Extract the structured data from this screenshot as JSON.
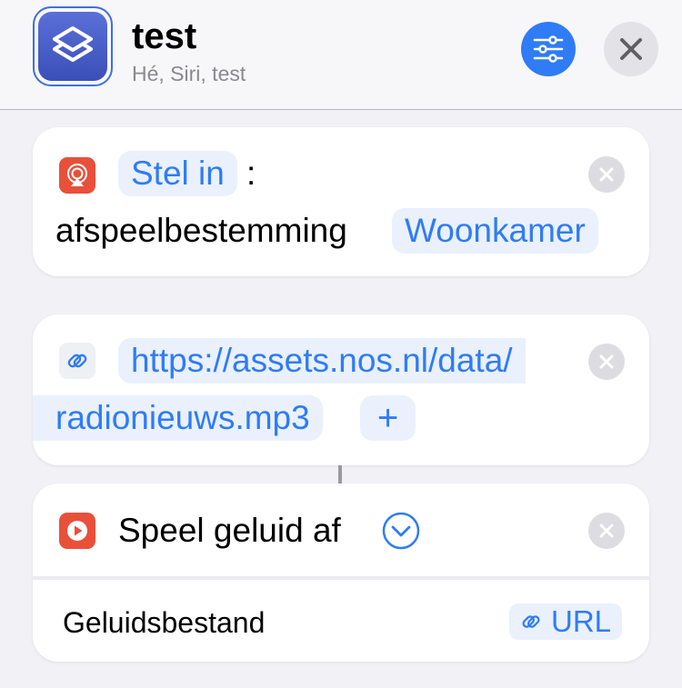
{
  "header": {
    "title": "test",
    "subtitle": "Hé, Siri, test",
    "app_icon": "shortcuts-icon",
    "settings_icon": "sliders-icon",
    "close_icon": "close-icon",
    "accent_color": "#2f7cf6"
  },
  "actions": [
    {
      "icon": "airplay-icon",
      "icon_color": "#e8503a",
      "verb": "Stel in",
      "colon": ":",
      "text": "afspeelbestemming",
      "value": "Woonkamer"
    },
    {
      "icon": "link-icon",
      "url_line1": "https://assets.nos.nl/data/",
      "url_line2": "radionieuws.mp3",
      "add_label": "+"
    },
    {
      "icon": "play-icon",
      "icon_color": "#e8503a",
      "title": "Speel geluid af",
      "expand_icon": "chevron-down-circle-icon",
      "param_label": "Geluidsbestand",
      "param_value": "URL",
      "param_icon": "link-icon"
    }
  ]
}
